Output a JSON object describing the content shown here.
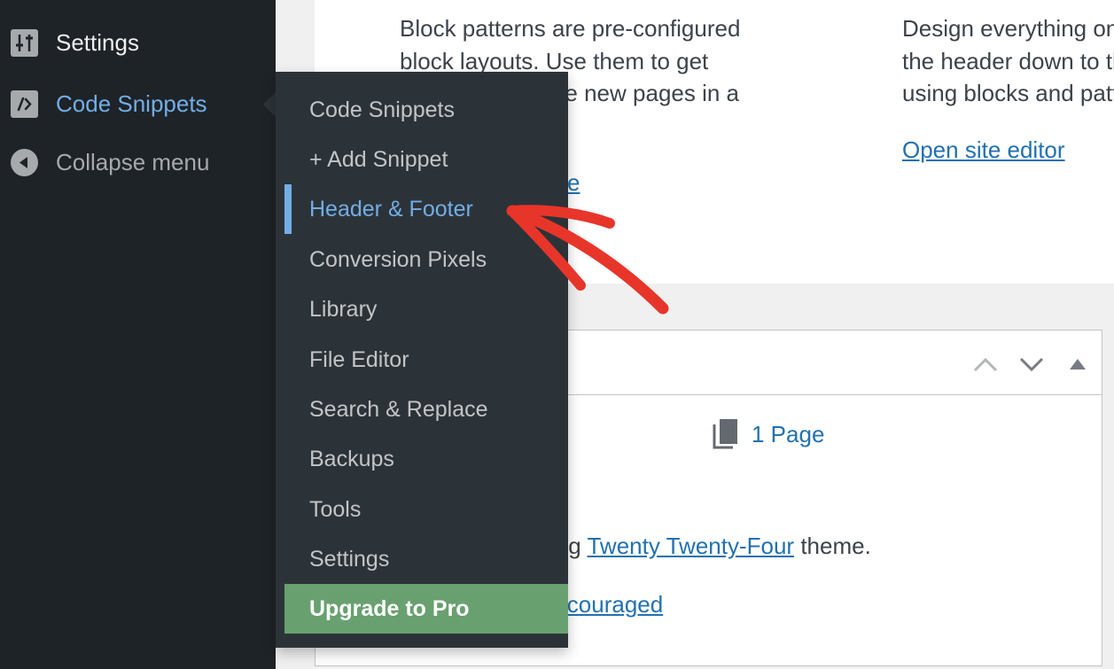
{
  "sidebar": {
    "items": [
      {
        "label": "Settings",
        "icon": "sliders-icon",
        "state": "default"
      },
      {
        "label": "Code Snippets",
        "icon": "code-icon",
        "state": "active"
      },
      {
        "label": "Collapse menu",
        "icon": "collapse-arrow-icon",
        "state": "muted"
      }
    ]
  },
  "flyout": {
    "parent": "Code Snippets",
    "items": [
      {
        "label": "Code Snippets"
      },
      {
        "label": "+ Add Snippet"
      },
      {
        "label": "Header & Footer",
        "current": true
      },
      {
        "label": "Conversion Pixels"
      },
      {
        "label": "Library"
      },
      {
        "label": "File Editor"
      },
      {
        "label": "Search & Replace"
      },
      {
        "label": "Backups"
      },
      {
        "label": "Tools"
      },
      {
        "label": "Settings"
      },
      {
        "label": "Upgrade to Pro",
        "highlight": true
      }
    ]
  },
  "main": {
    "patterns_text_lines": [
      "Block patterns are pre-configured",
      "block layouts. Use them to get",
      "inspired or create new pages in a"
    ],
    "patterns_link_partial": "e",
    "site_editor_text_lines": [
      "Design everything on your site from",
      "the header down to the footer, all",
      "using blocks and patterns."
    ],
    "site_editor_link": "Open site editor",
    "glance": {
      "pages_label": "1 Page",
      "icon": "pages-icon"
    },
    "theme_prefix": "You are using",
    "theme_prefix_visible": "ing",
    "theme_link": "Twenty Twenty-Four",
    "theme_suffix": "theme.",
    "search_link_partial": "iscouraged",
    "header_controls": [
      "move-up",
      "move-down",
      "toggle-panel"
    ]
  },
  "colors": {
    "sidebar_bg": "#1e2327",
    "flyout_bg": "#2c3338",
    "accent_blue": "#72aee6",
    "link_blue": "#2271b1",
    "upgrade_green": "#68a16f",
    "annotation_red": "#e8352a"
  }
}
